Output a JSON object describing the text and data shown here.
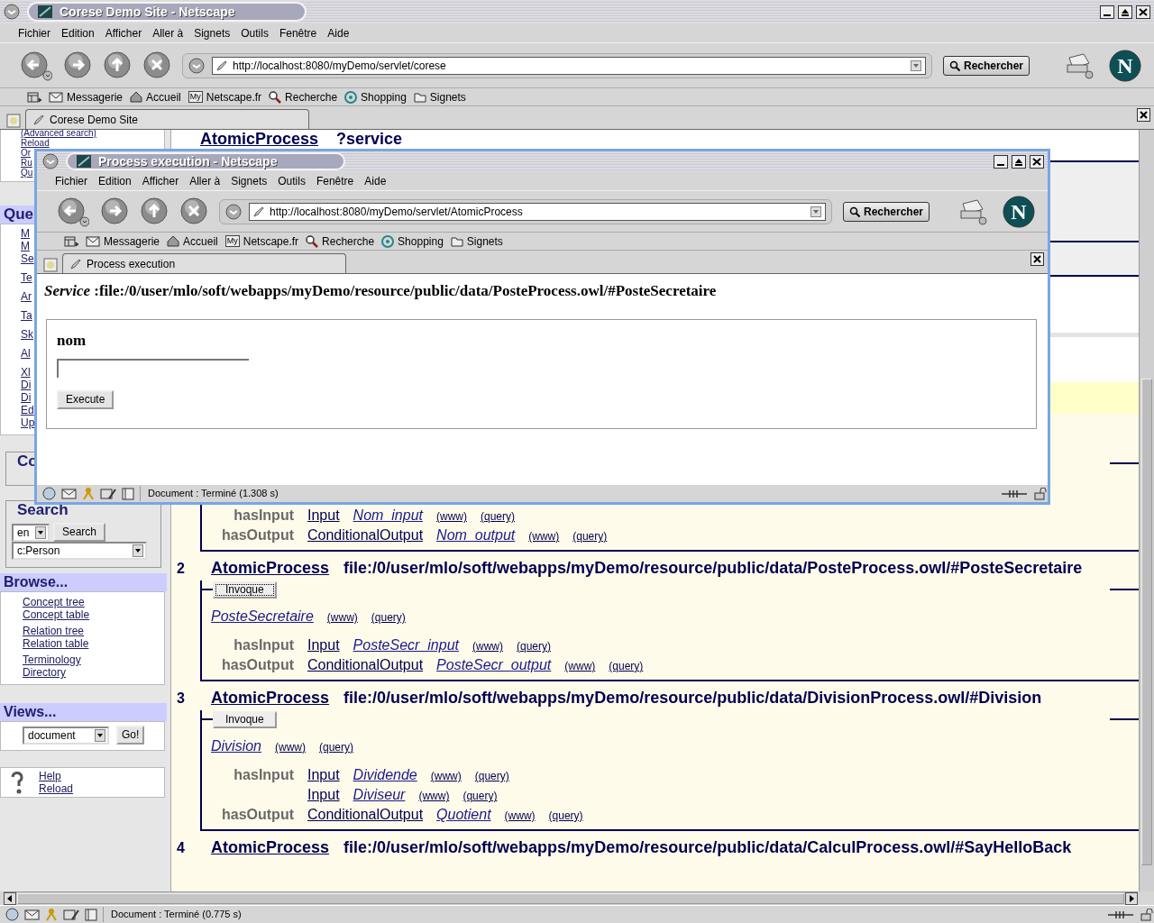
{
  "browser": {
    "title": "Corese Demo Site - Netscape",
    "menu": [
      "Fichier",
      "Edition",
      "Afficher",
      "Aller à",
      "Signets",
      "Outils",
      "Fenêtre",
      "Aide"
    ],
    "url": "http://localhost:8080/myDemo/servlet/corese",
    "search_button": "Rechercher",
    "logo": "N",
    "bookmarks": [
      {
        "kind": "mail",
        "label": "Messagerie"
      },
      {
        "kind": "home",
        "label": "Accueil"
      },
      {
        "kind": "my",
        "badge": "My",
        "label": "Netscape.fr"
      },
      {
        "kind": "search",
        "label": "Recherche"
      },
      {
        "kind": "shop",
        "label": "Shopping"
      },
      {
        "kind": "folder",
        "label": "Signets"
      }
    ],
    "tab": "Corese Demo Site",
    "status": "Document : Terminé (0.775 s)"
  },
  "sidebar": {
    "top_links": [
      "(Advanced search)",
      "Reload",
      "Or",
      "Ru",
      "Qu"
    ],
    "query_heading": "Que",
    "query_links": [
      "M",
      "M",
      "Se",
      "Te",
      "Ar",
      "Ta",
      "Sk",
      "Al",
      "Xl",
      "Di",
      "Di",
      "Ed",
      "Up"
    ],
    "concept_legend": "Co",
    "search": {
      "legend": "Search",
      "language": "en",
      "button": "Search",
      "concept": "c:Person"
    },
    "browse": {
      "heading": "Browse...",
      "links": [
        "Concept tree",
        "Concept table",
        "Relation tree",
        "Relation table",
        "Terminology",
        "Directory"
      ]
    },
    "views": {
      "heading": "Views...",
      "view": "document",
      "button": "Go!"
    },
    "help": [
      "Help",
      "Reload"
    ]
  },
  "results": {
    "header": {
      "process": "AtomicProcess",
      "name": "?service"
    },
    "items": [
      {
        "rows": [
          {
            "property": "hasInput",
            "class": "Input",
            "name": "Nom_input",
            "www": "(www)",
            "query": "(query)"
          },
          {
            "property": "hasOutput",
            "class": "ConditionalOutput",
            "name": "Nom_output",
            "www": "(www)",
            "query": "(query)"
          }
        ]
      },
      {
        "number": "2",
        "process": "AtomicProcess",
        "uri": "file:/0/user/mlo/soft/webapps/myDemo/resource/public/data/PosteProcess.owl/#PosteSecretaire",
        "button": "Invoque",
        "focused": true,
        "resource": {
          "name": "PosteSecretaire",
          "www": "(www)",
          "query": "(query)"
        },
        "rows": [
          {
            "property": "hasInput",
            "class": "Input",
            "name": "PosteSecr_input",
            "www": "(www)",
            "query": "(query)"
          },
          {
            "property": "hasOutput",
            "class": "ConditionalOutput",
            "name": "PosteSecr_output",
            "www": "(www)",
            "query": "(query)"
          }
        ]
      },
      {
        "number": "3",
        "process": "AtomicProcess",
        "uri": "file:/0/user/mlo/soft/webapps/myDemo/resource/public/data/DivisionProcess.owl/#Division",
        "button": "Invoque",
        "focused": false,
        "resource": {
          "name": "Division",
          "www": "(www)",
          "query": "(query)"
        },
        "rows": [
          {
            "property": "hasInput",
            "class": "Input",
            "name": "Dividende",
            "www": "(www)",
            "query": "(query)"
          },
          {
            "class": "Input",
            "name": "Diviseur",
            "www": "(www)",
            "query": "(query)"
          },
          {
            "property": "hasOutput",
            "class": "ConditionalOutput",
            "name": "Quotient",
            "www": "(www)",
            "query": "(query)"
          }
        ]
      },
      {
        "number": "4",
        "process": "AtomicProcess",
        "uri": "file:/0/user/mlo/soft/webapps/myDemo/resource/public/data/CalculProcess.owl/#SayHelloBack"
      }
    ]
  },
  "popup": {
    "title": "Process execution - Netscape",
    "menu": [
      "Fichier",
      "Edition",
      "Afficher",
      "Aller à",
      "Signets",
      "Outils",
      "Fenêtre",
      "Aide"
    ],
    "url": "http://localhost:8080/myDemo/servlet/AtomicProcess",
    "search_button": "Rechercher",
    "logo": "N",
    "bookmarks": [
      {
        "kind": "mail",
        "label": "Messagerie"
      },
      {
        "kind": "home",
        "label": "Accueil"
      },
      {
        "kind": "my",
        "badge": "My",
        "label": "Netscape.fr"
      },
      {
        "kind": "search",
        "label": "Recherche"
      },
      {
        "kind": "shop",
        "label": "Shopping"
      },
      {
        "kind": "folder",
        "label": "Signets"
      }
    ],
    "tab": "Process execution",
    "status": "Document : Terminé (1.308 s)",
    "service": "*Service* :file:/0/user/mlo/soft/webapps/myDemo/resource/public/data/PosteProcess.owl/#PosteSecretaire",
    "field_label": "nom",
    "button": "Execute"
  }
}
